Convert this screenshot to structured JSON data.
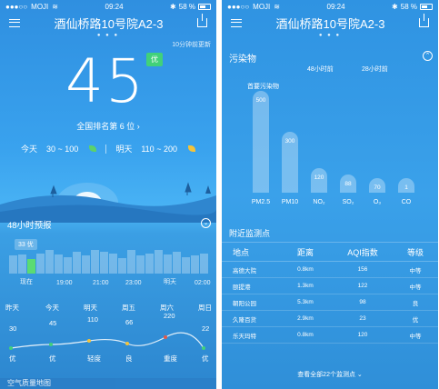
{
  "left": {
    "status": {
      "carrier": "MOJI",
      "time": "09:24",
      "battery": "58 %"
    },
    "title": "酒仙桥路10号院A2-3",
    "update_note": "10分钟前更新",
    "aqi": "45",
    "aqi_level": "优",
    "rank": "全国排名第 6 位 ›",
    "today_label": "今天",
    "today_range": "30 ~ 100",
    "tomorrow_label": "明天",
    "tomorrow_range": "110 ~ 200",
    "forecast_title": "48小时预报",
    "hour_tooltip": "33 优",
    "hour_labels": [
      "现在",
      "19:00",
      "21:00",
      "23:00",
      "明天",
      "02:00"
    ],
    "day_names": [
      "昨天",
      "今天",
      "明天",
      "周五",
      "周六",
      "周日"
    ],
    "day_values": [
      "30",
      "45",
      "110",
      "66",
      "220",
      "22"
    ],
    "day_quality": [
      "优",
      "优",
      "轻度",
      "良",
      "重度",
      "优"
    ],
    "bottom_link": "空气质量地图"
  },
  "right": {
    "status": {
      "carrier": "MOJI",
      "time": "09:24",
      "battery": "58 %"
    },
    "title": "酒仙桥路10号院A2-3",
    "pollutants_title": "污染物",
    "tab_48h": "48小时前",
    "tab_28h": "28小时前",
    "primary_label": "首要污染物",
    "pollutants": [
      {
        "name": "PM2.5",
        "value": "500"
      },
      {
        "name": "PM10",
        "value": "300"
      },
      {
        "name": "NO₂",
        "value": "120"
      },
      {
        "name": "SO₂",
        "value": "88"
      },
      {
        "name": "O₃",
        "value": "70"
      },
      {
        "name": "CO",
        "value": "1"
      }
    ],
    "stations_title": "附近监测点",
    "table_headers": [
      "地点",
      "距离",
      "AQI指数",
      "等级"
    ],
    "stations": [
      {
        "place": "高德大院",
        "distance": "0.8km",
        "aqi": "156",
        "level": "中等"
      },
      {
        "place": "颐提港",
        "distance": "1.3km",
        "aqi": "122",
        "level": "中等"
      },
      {
        "place": "朝阳公园",
        "distance": "5.3km",
        "aqi": "98",
        "level": "良"
      },
      {
        "place": "久隆百货",
        "distance": "2.9km",
        "aqi": "23",
        "level": "优"
      },
      {
        "place": "乐天玛特",
        "distance": "0.8km",
        "aqi": "120",
        "level": "中等"
      }
    ],
    "view_all": "查看全部22个监测点 ⌄"
  },
  "colors": {
    "good": "#41d17a",
    "leaf_green": "#5bd16b",
    "leaf_yellow": "#f4c33a"
  }
}
